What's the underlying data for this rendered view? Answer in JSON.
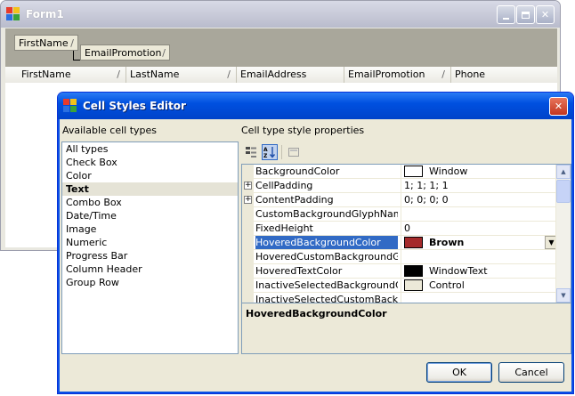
{
  "form1": {
    "title": "Form1",
    "group_chips": [
      {
        "label": "FirstName",
        "sort": "/"
      },
      {
        "label": "EmailPromotion",
        "sort": "/"
      }
    ],
    "columns": [
      {
        "label": "FirstName",
        "sort": "/"
      },
      {
        "label": "LastName",
        "sort": "/"
      },
      {
        "label": "EmailAddress",
        "sort": ""
      },
      {
        "label": "EmailPromotion",
        "sort": "/"
      },
      {
        "label": "Phone",
        "sort": ""
      }
    ]
  },
  "dialog": {
    "title": "Cell Styles Editor",
    "available_label": "Available cell types",
    "props_label": "Cell type style properties",
    "cell_types": [
      "All types",
      "Check Box",
      "Color",
      "Text",
      "Combo Box",
      "Date/Time",
      "Image",
      "Numeric",
      "Progress Bar",
      "Column Header",
      "Group Row"
    ],
    "selected_type": "Text",
    "toolbar": [
      "categorized-icon",
      "alphabetical-icon",
      "property-pages-icon"
    ],
    "properties": [
      {
        "name": "BackgroundColor",
        "value": "Window",
        "swatch": "#ffffff",
        "expandable": false
      },
      {
        "name": "CellPadding",
        "value": "1; 1; 1; 1",
        "swatch": null,
        "expandable": true
      },
      {
        "name": "ContentPadding",
        "value": "0; 0; 0; 0",
        "swatch": null,
        "expandable": true
      },
      {
        "name": "CustomBackgroundGlyphName",
        "value": "",
        "swatch": null,
        "expandable": false
      },
      {
        "name": "FixedHeight",
        "value": "0",
        "swatch": null,
        "expandable": false
      },
      {
        "name": "HoveredBackgroundColor",
        "value": "Brown",
        "swatch": "#a52a2a",
        "expandable": false
      },
      {
        "name": "HoveredCustomBackgroundGlyph",
        "value": "",
        "swatch": null,
        "expandable": false
      },
      {
        "name": "HoveredTextColor",
        "value": "WindowText",
        "swatch": "#000000",
        "expandable": false
      },
      {
        "name": "InactiveSelectedBackgroundColo",
        "value": "Control",
        "swatch": "#ece9d8",
        "expandable": false
      },
      {
        "name": "InactiveSelectedCustomBackgrou",
        "value": "",
        "swatch": null,
        "expandable": false
      }
    ],
    "selected_property": "HoveredBackgroundColor",
    "description_title": "HoveredBackgroundColor",
    "ok_label": "OK",
    "cancel_label": "Cancel"
  },
  "colors": {
    "xp_blue": "#0050e0",
    "selection": "#316ac5",
    "control": "#ece9d8"
  }
}
